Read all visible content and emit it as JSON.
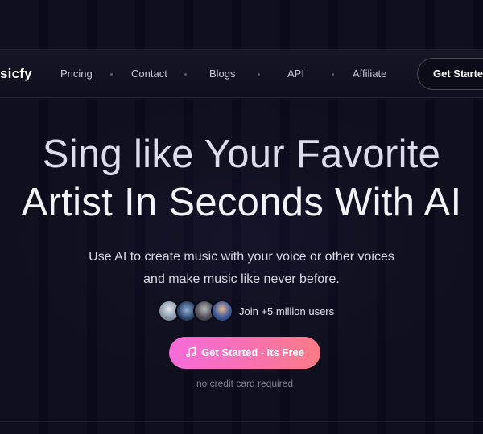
{
  "nav": {
    "logo": "sicfy",
    "links": [
      "Pricing",
      "Contact",
      "Blogs",
      "API",
      "Affiliate"
    ],
    "cta": "Get Started"
  },
  "hero": {
    "title_line1": "Sing like Your Favorite",
    "title_line2": "Artist In Seconds With AI",
    "subtitle_line1": "Use AI to create music with your voice or other voices",
    "subtitle_line2": "and make music like never before."
  },
  "social_proof": {
    "text": "Join +5 million users"
  },
  "cta": {
    "label": "Get Started - Its Free",
    "icon": "music-note-icon"
  },
  "disclaimer": "no credit card required",
  "colors": {
    "background": "#0a0a18",
    "cta_gradient_start": "#f56bd9",
    "cta_gradient_end": "#fb7b84"
  }
}
